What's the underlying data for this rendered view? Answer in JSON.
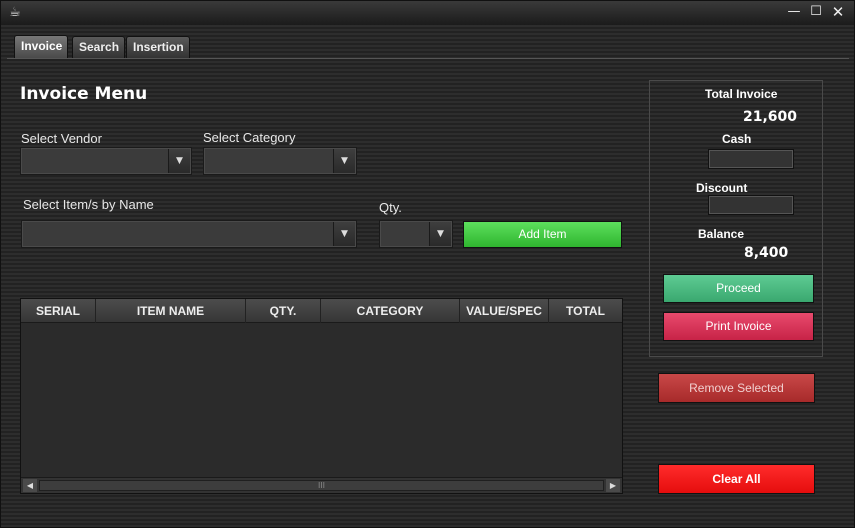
{
  "window": {
    "app_icon": "cup-icon",
    "minimize_glyph": "—",
    "maximize_glyph": "☐",
    "close_glyph": "✕"
  },
  "tabs": [
    {
      "label": "Invoice",
      "active": true
    },
    {
      "label": "Search",
      "active": false
    },
    {
      "label": "Insertion",
      "active": false
    }
  ],
  "form": {
    "heading": "Invoice Menu",
    "vendor_label": "Select Vendor",
    "vendor_value": "",
    "category_label": "Select Category",
    "category_value": "",
    "item_label": "Select Item/s by Name",
    "item_value": "",
    "qty_label": "Qty.",
    "qty_value": "",
    "add_item_label": "Add Item"
  },
  "table": {
    "columns": [
      "SERIAL",
      "ITEM NAME",
      "QTY.",
      "CATEGORY",
      "VALUE/SPEC",
      "TOTAL"
    ],
    "rows": [],
    "scroll_grip": "III"
  },
  "summary": {
    "total_invoice_label": "Total Invoice",
    "total_invoice_value": "21,600",
    "cash_label": "Cash",
    "cash_value": "",
    "discount_label": "Discount",
    "discount_value": "",
    "balance_label": "Balance",
    "balance_value": "8,400"
  },
  "actions": {
    "proceed_label": "Proceed",
    "print_invoice_label": "Print Invoice",
    "remove_selected_label": "Remove Selected",
    "clear_all_label": "Clear All"
  },
  "colors": {
    "add_item": "#3fc93f",
    "proceed": "#4bb981",
    "print_invoice": "#d9345a",
    "remove_selected": "#b83838",
    "clear_all": "#f21b1b"
  }
}
